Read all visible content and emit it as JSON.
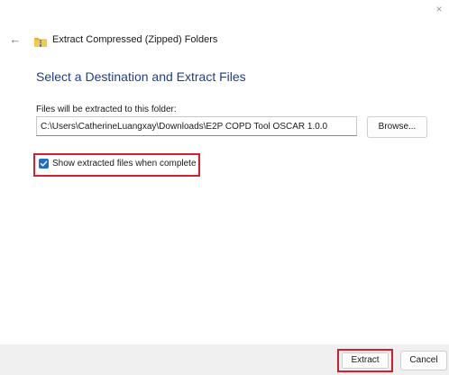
{
  "window": {
    "title": "Extract Compressed (Zipped) Folders",
    "close_glyph": "×",
    "back_glyph": "←",
    "icons": [
      "close-icon",
      "back-arrow-icon",
      "zip-folder-icon",
      "checkmark-icon"
    ]
  },
  "main": {
    "heading": "Select a Destination and Extract Files",
    "destination_label": "Files will be extracted to this folder:",
    "destination_path": "C:\\Users\\CatherineLuangxay\\Downloads\\E2P COPD Tool OSCAR 1.0.0",
    "browse_label": "Browse...",
    "show_files_label": "Show extracted files when complete",
    "show_files_checked": true
  },
  "footer": {
    "extract_label": "Extract",
    "cancel_label": "Cancel"
  },
  "colors": {
    "heading": "#1e3f8a",
    "accent": "#1f6fc7",
    "highlight": "#d21f2c",
    "footer_bg": "#f0f0f0"
  }
}
